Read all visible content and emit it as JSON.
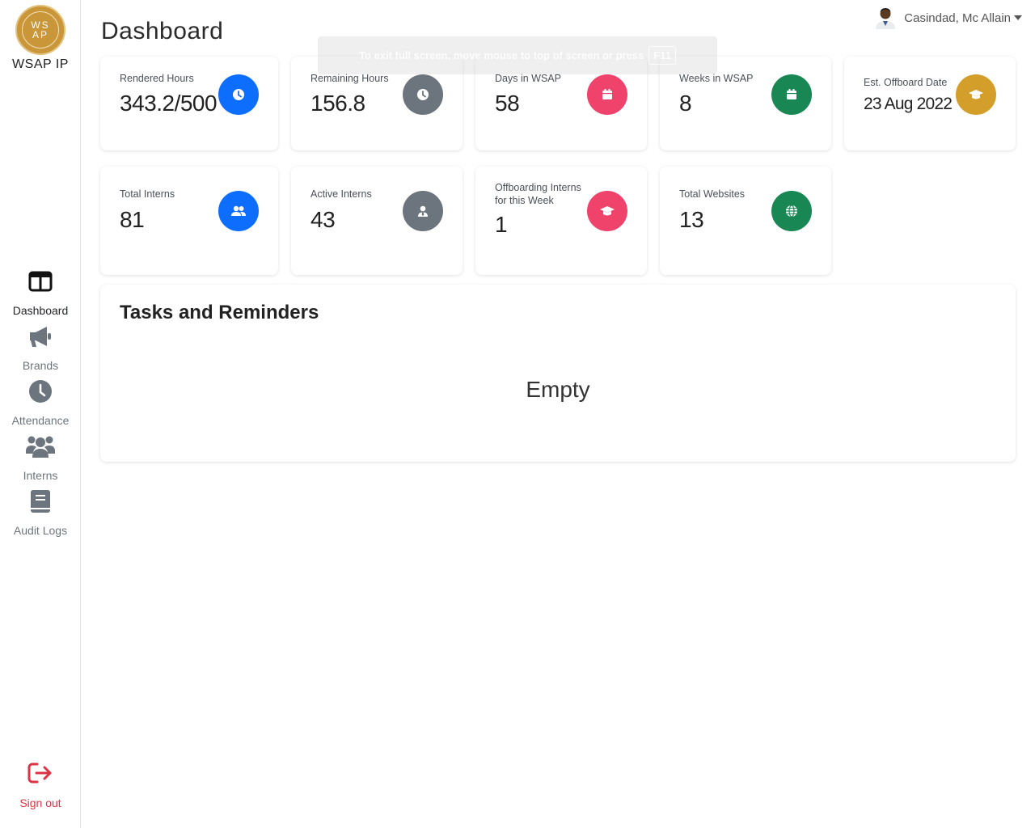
{
  "app": {
    "logo_line1": "WS",
    "logo_line2": "AP",
    "name": "WSAP IP"
  },
  "page": {
    "title": "Dashboard"
  },
  "user": {
    "name": "Casindad, Mc Allain"
  },
  "sidebar": {
    "items": [
      {
        "label": "Dashboard",
        "icon": "layout-columns-icon",
        "active": true
      },
      {
        "label": "Brands",
        "icon": "megaphone-icon"
      },
      {
        "label": "Attendance",
        "icon": "clock-icon"
      },
      {
        "label": "Interns",
        "icon": "users-icon"
      },
      {
        "label": "Audit Logs",
        "icon": "book-icon"
      }
    ],
    "signout": {
      "label": "Sign out",
      "icon": "sign-out-icon",
      "color": "#dc3545"
    }
  },
  "stats": [
    {
      "label": "Rendered Hours",
      "value": "343.2/500",
      "icon": "clock-icon",
      "color": "#0d6efd"
    },
    {
      "label": "Remaining Hours",
      "value": "156.8",
      "icon": "clock-icon",
      "color": "#6c757d"
    },
    {
      "label": "Days in WSAP",
      "value": "58",
      "icon": "calendar-icon",
      "color": "#f0436b"
    },
    {
      "label": "Weeks in WSAP",
      "value": "8",
      "icon": "calendar-icon",
      "color": "#198754"
    },
    {
      "label": "Est. Offboard Date",
      "value": "23 Aug 2022",
      "icon": "graduation-cap-icon",
      "color": "#d39e2a"
    },
    {
      "label": "Total Interns",
      "value": "81",
      "icon": "users-icon",
      "color": "#0d6efd"
    },
    {
      "label": "Active Interns",
      "value": "43",
      "icon": "user-tie-icon",
      "color": "#6c757d"
    },
    {
      "label": "Offboarding Interns for this Week",
      "value": "1",
      "icon": "graduation-cap-icon",
      "color": "#f0436b"
    },
    {
      "label": "Total Websites",
      "value": "13",
      "icon": "globe-icon",
      "color": "#198754"
    }
  ],
  "tasks": {
    "title": "Tasks and Reminders",
    "empty_text": "Empty"
  },
  "overlay": {
    "message": "To exit full screen, move mouse to top of screen or press",
    "key": "F11"
  }
}
